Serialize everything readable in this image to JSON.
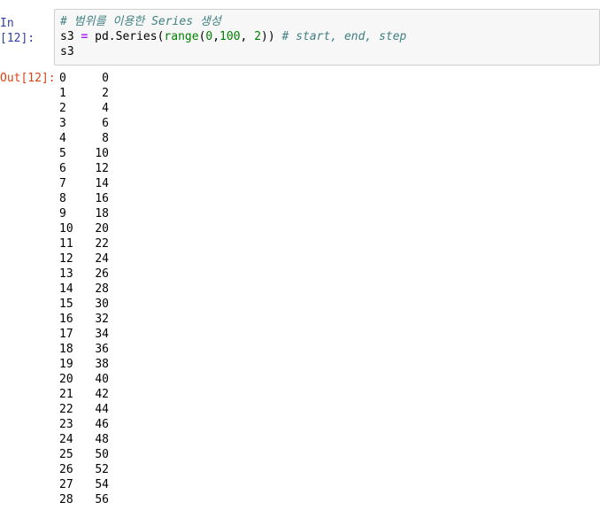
{
  "input_cell": {
    "prompt": "In [12]:",
    "code": {
      "line1": "# 범위를 이용한 Series 생성",
      "line2_var": "s3",
      "line2_op": "=",
      "line2_pd": "pd.Series(",
      "line2_range": "range",
      "line2_args_open": "(",
      "line2_n0": "0",
      "line2_c1": ",",
      "line2_n100": "100",
      "line2_c2": ", ",
      "line2_n2": "2",
      "line2_close": "))",
      "line2_comment": "# start, end, step",
      "line3": "s3"
    }
  },
  "output_cell": {
    "prompt": "Out[12]:",
    "rows": [
      {
        "index": "0",
        "value": "0"
      },
      {
        "index": "1",
        "value": "2"
      },
      {
        "index": "2",
        "value": "4"
      },
      {
        "index": "3",
        "value": "6"
      },
      {
        "index": "4",
        "value": "8"
      },
      {
        "index": "5",
        "value": "10"
      },
      {
        "index": "6",
        "value": "12"
      },
      {
        "index": "7",
        "value": "14"
      },
      {
        "index": "8",
        "value": "16"
      },
      {
        "index": "9",
        "value": "18"
      },
      {
        "index": "10",
        "value": "20"
      },
      {
        "index": "11",
        "value": "22"
      },
      {
        "index": "12",
        "value": "24"
      },
      {
        "index": "13",
        "value": "26"
      },
      {
        "index": "14",
        "value": "28"
      },
      {
        "index": "15",
        "value": "30"
      },
      {
        "index": "16",
        "value": "32"
      },
      {
        "index": "17",
        "value": "34"
      },
      {
        "index": "18",
        "value": "36"
      },
      {
        "index": "19",
        "value": "38"
      },
      {
        "index": "20",
        "value": "40"
      },
      {
        "index": "21",
        "value": "42"
      },
      {
        "index": "22",
        "value": "44"
      },
      {
        "index": "23",
        "value": "46"
      },
      {
        "index": "24",
        "value": "48"
      },
      {
        "index": "25",
        "value": "50"
      },
      {
        "index": "26",
        "value": "52"
      },
      {
        "index": "27",
        "value": "54"
      },
      {
        "index": "28",
        "value": "56"
      }
    ]
  }
}
